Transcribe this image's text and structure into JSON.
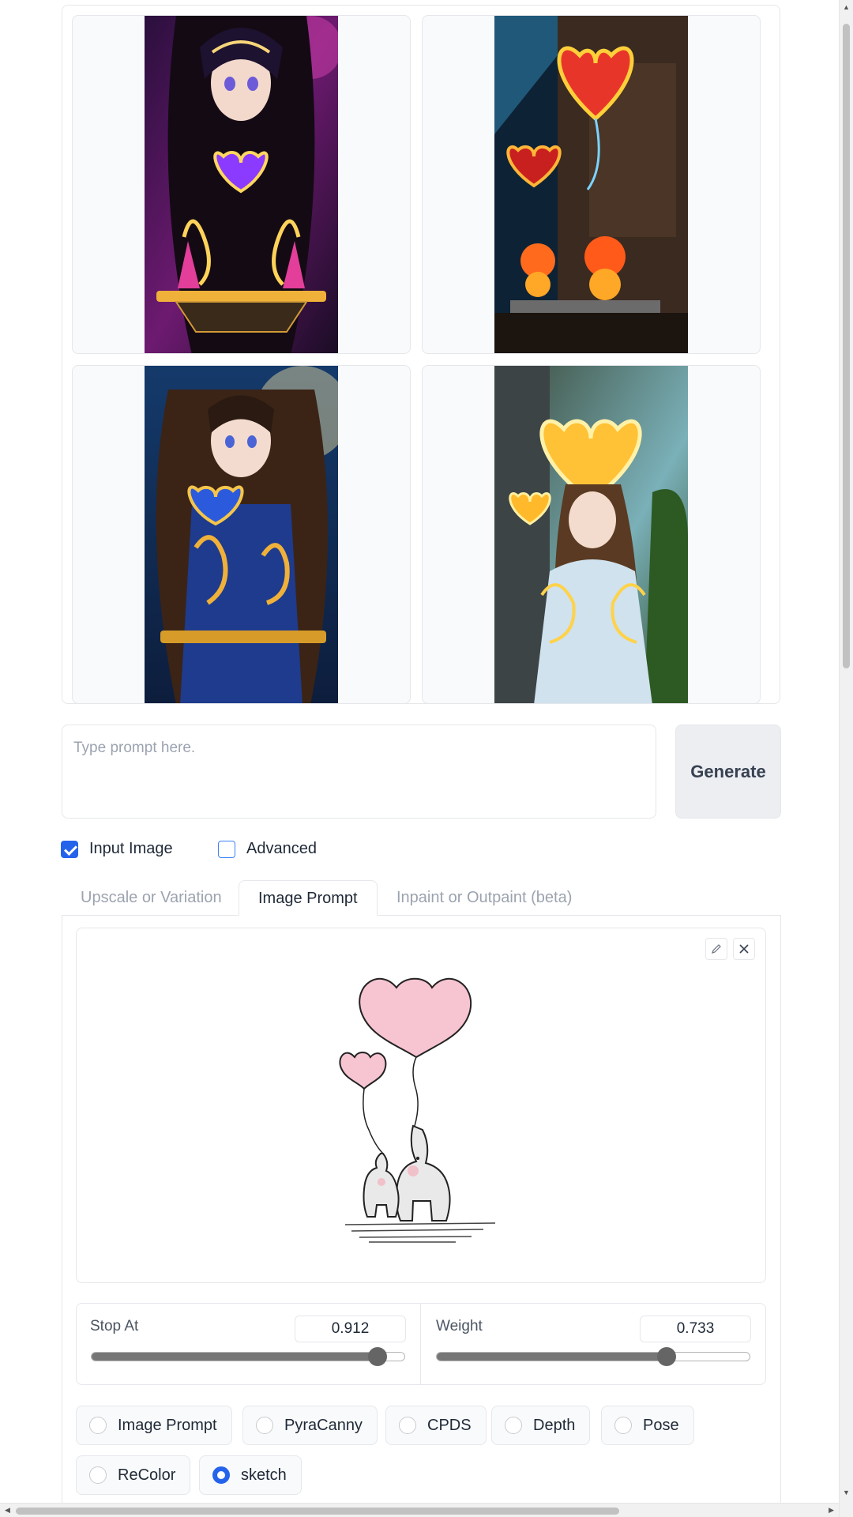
{
  "gallery": {
    "images": [
      {
        "alt": "anime girl with purple glowing heart"
      },
      {
        "alt": "glowing red heart lanterns"
      },
      {
        "alt": "anime girl with blue heart"
      },
      {
        "alt": "girl with golden glowing heart"
      }
    ]
  },
  "prompt": {
    "placeholder": "Type prompt here.",
    "value": ""
  },
  "generate_label": "Generate",
  "options": {
    "input_image_label": "Input Image",
    "input_image_checked": true,
    "advanced_label": "Advanced",
    "advanced_checked": false
  },
  "tabs": [
    {
      "label": "Upscale or Variation",
      "active": false
    },
    {
      "label": "Image Prompt",
      "active": true
    },
    {
      "label": "Inpaint or Outpaint (beta)",
      "active": false
    }
  ],
  "image_prompt": {
    "image": {
      "alt": "elephants with heart balloons sketch"
    },
    "stop_at": {
      "label": "Stop At",
      "value": "0.912",
      "fraction": 0.912
    },
    "weight": {
      "label": "Weight",
      "value": "0.733",
      "fraction": 0.733
    },
    "types": [
      {
        "label": "Image Prompt",
        "selected": false
      },
      {
        "label": "PyraCanny",
        "selected": false
      },
      {
        "label": "CPDS",
        "selected": false
      },
      {
        "label": "Depth",
        "selected": false
      },
      {
        "label": "Pose",
        "selected": false
      },
      {
        "label": "ReColor",
        "selected": false
      },
      {
        "label": "sketch",
        "selected": true
      }
    ]
  },
  "colors": {
    "accent": "#2563eb",
    "border": "#e5e7eb"
  }
}
